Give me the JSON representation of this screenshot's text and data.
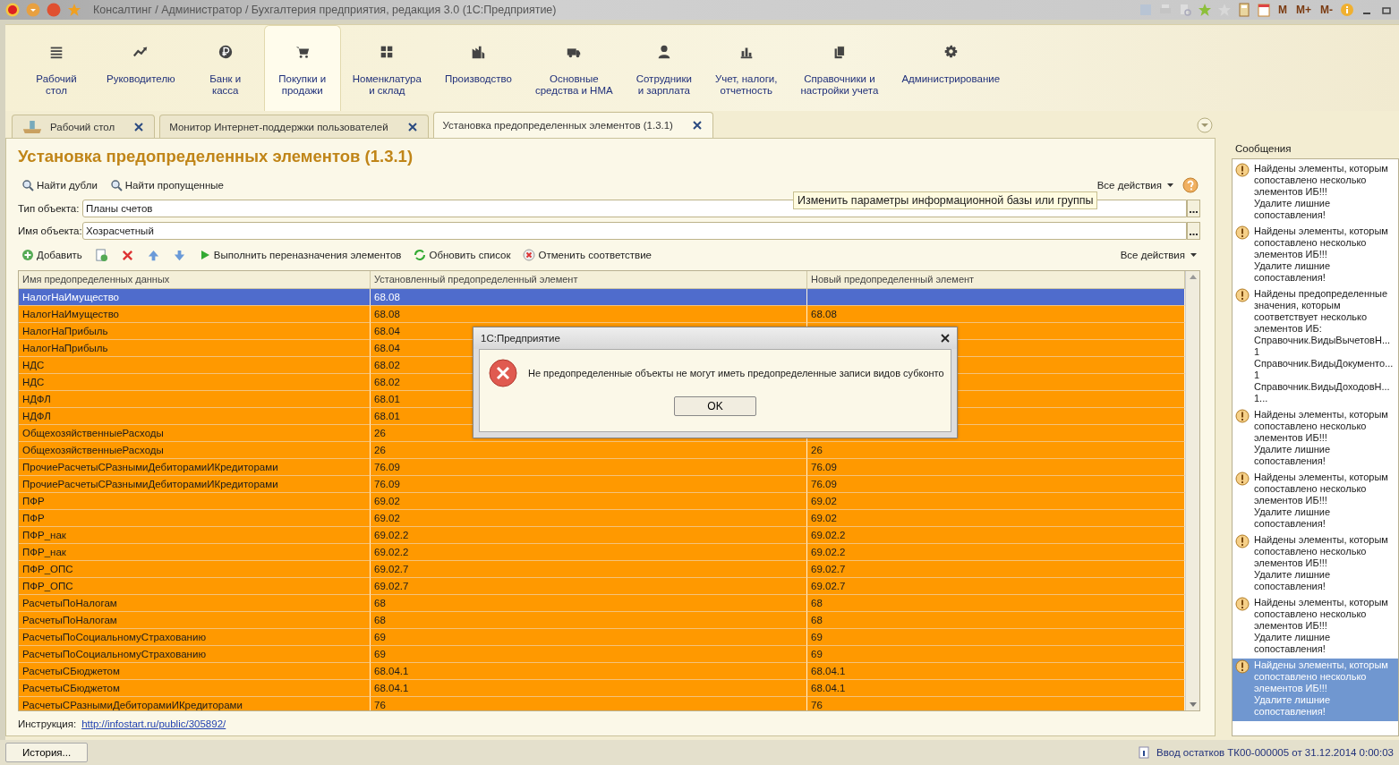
{
  "titlebar": {
    "title": "Консалтинг / Администратор / Бухгалтерия предприятия, редакция 3.0  (1С:Предприятие)",
    "memory_buttons": [
      "M",
      "M+",
      "M-"
    ]
  },
  "sections": [
    {
      "label": "Рабочий\nстол",
      "selected": false
    },
    {
      "label": "Руководителю",
      "selected": false
    },
    {
      "label": "Банк и\nкасса",
      "selected": false
    },
    {
      "label": "Покупки и\nпродажи",
      "selected": true
    },
    {
      "label": "Номенклатура\nи склад",
      "selected": false
    },
    {
      "label": "Производство",
      "selected": false
    },
    {
      "label": "Основные\nсредства и НМА",
      "selected": false
    },
    {
      "label": "Сотрудники\nи зарплата",
      "selected": false
    },
    {
      "label": "Учет, налоги,\nотчетность",
      "selected": false
    },
    {
      "label": "Справочники и\nнастройки учета",
      "selected": false
    },
    {
      "label": "Администрирование",
      "selected": false
    }
  ],
  "tabs": [
    {
      "label": "Рабочий стол",
      "selected": false
    },
    {
      "label": "Монитор Интернет-поддержки пользователей",
      "selected": false
    },
    {
      "label": "Установка предопределенных элементов (1.3.1)",
      "selected": true
    }
  ],
  "form": {
    "title": "Установка предопределенных элементов (1.3.1)",
    "commands": [
      "Найти дубли",
      "Найти пропущенные"
    ],
    "all_actions": "Все действия",
    "fields": [
      {
        "label": "Тип объекта:",
        "value": "Планы счетов"
      },
      {
        "label": "Имя объекта:",
        "value": "Хозрасчетный"
      }
    ],
    "tooltip": "Изменить параметры информационной базы или группы",
    "table_commands": [
      "Добавить",
      "Выполнить переназначения элементов",
      "Обновить список",
      "Отменить соответствие"
    ],
    "table_all_actions": "Все действия",
    "table": {
      "columns": [
        "Имя предопределенных данных",
        "Установленный предопределенный элемент",
        "Новый предопределенный элемент"
      ],
      "rows": [
        {
          "name": "НалогНаИмущество",
          "current": "68.08",
          "selected": true
        },
        {
          "name": "НалогНаИмущество",
          "current": "68.08",
          "new": "68.08",
          "selected": false
        },
        {
          "name": "НалогНаПрибыль",
          "current": "68.04",
          "selected": false
        },
        {
          "name": "НалогНаПрибыль",
          "current": "68.04",
          "selected": false
        },
        {
          "name": "НДС",
          "current": "68.02",
          "selected": false
        },
        {
          "name": "НДС",
          "current": "68.02",
          "selected": false
        },
        {
          "name": "НДФЛ",
          "current": "68.01",
          "selected": false
        },
        {
          "name": "НДФЛ",
          "current": "68.01",
          "selected": false
        },
        {
          "name": "ОбщехозяйственныеРасходы",
          "current": "26",
          "selected": false
        },
        {
          "name": "ОбщехозяйственныеРасходы",
          "current": "26",
          "new": "26",
          "selected": false
        },
        {
          "name": "ПрочиеРасчетыСРазнымиДебиторамиИКредиторами",
          "current": "76.09",
          "new": "76.09",
          "selected": false
        },
        {
          "name": "ПрочиеРасчетыСРазнымиДебиторамиИКредиторами",
          "current": "76.09",
          "new": "76.09",
          "selected": false
        },
        {
          "name": "ПФР",
          "current": "69.02",
          "new": "69.02",
          "selected": false
        },
        {
          "name": "ПФР",
          "current": "69.02",
          "new": "69.02",
          "selected": false
        },
        {
          "name": "ПФР_нак",
          "current": "69.02.2",
          "new": "69.02.2",
          "selected": false
        },
        {
          "name": "ПФР_нак",
          "current": "69.02.2",
          "new": "69.02.2",
          "selected": false
        },
        {
          "name": "ПФР_ОПС",
          "current": "69.02.7",
          "new": "69.02.7",
          "selected": false
        },
        {
          "name": "ПФР_ОПС",
          "current": "69.02.7",
          "new": "69.02.7",
          "selected": false
        },
        {
          "name": "РасчетыПоНалогам",
          "current": "68",
          "new": "68",
          "selected": false
        },
        {
          "name": "РасчетыПоНалогам",
          "current": "68",
          "new": "68",
          "selected": false
        },
        {
          "name": "РасчетыПоСоциальномуСтрахованию",
          "current": "69",
          "new": "69",
          "selected": false
        },
        {
          "name": "РасчетыПоСоциальномуСтрахованию",
          "current": "69",
          "new": "69",
          "selected": false
        },
        {
          "name": "РасчетыСБюджетом",
          "current": "68.04.1",
          "new": "68.04.1",
          "selected": false
        },
        {
          "name": "РасчетыСБюджетом",
          "current": "68.04.1",
          "new": "68.04.1",
          "selected": false
        },
        {
          "name": "РасчетыСРазнымиДебиторамиИКредиторами",
          "current": "76",
          "new": "76",
          "selected": false
        }
      ]
    },
    "instruction_label": "Инструкция:",
    "instruction_link": "http://infostart.ru/public/305892/"
  },
  "dialog": {
    "title": "1С:Предприятие",
    "message": "Не предопределенные объекты не могут иметь предопределенные записи видов субконто",
    "button": "OK"
  },
  "messages": {
    "title": "Сообщения",
    "items": [
      {
        "text": "Найдены элементы, которым\nсопоставлено несколько\nэлементов ИБ!!!\nУдалите лишние\nсопоставления!",
        "selected": false
      },
      {
        "text": "Найдены элементы, которым\nсопоставлено несколько\nэлементов ИБ!!!\nУдалите лишние\nсопоставления!",
        "selected": false
      },
      {
        "text": "Найдены предопределенные\nзначения, которым\nсоответствует несколько\nэлементов ИБ:\nСправочник.ВидыВычетовН...\n 1\nСправочник.ВидыДокументо...\n 1\nСправочник.ВидыДоходовН...\n 1...",
        "selected": false
      },
      {
        "text": "Найдены элементы, которым\nсопоставлено несколько\nэлементов ИБ!!!\nУдалите лишние\nсопоставления!",
        "selected": false
      },
      {
        "text": "Найдены элементы, которым\nсопоставлено несколько\nэлементов ИБ!!!\nУдалите лишние\nсопоставления!",
        "selected": false
      },
      {
        "text": "Найдены элементы, которым\nсопоставлено несколько\nэлементов ИБ!!!\nУдалите лишние\nсопоставления!",
        "selected": false
      },
      {
        "text": "Найдены элементы, которым\nсопоставлено несколько\nэлементов ИБ!!!\nУдалите лишние\nсопоставления!",
        "selected": false
      },
      {
        "text": "Найдены элементы, которым\nсопоставлено несколько\nэлементов ИБ!!!\nУдалите лишние\nсопоставления!",
        "selected": true
      }
    ]
  },
  "status_bar": {
    "history_button": "История...",
    "text": "Ввод остатков ТК00-000005 от 31.12.2014 0:00:03"
  }
}
